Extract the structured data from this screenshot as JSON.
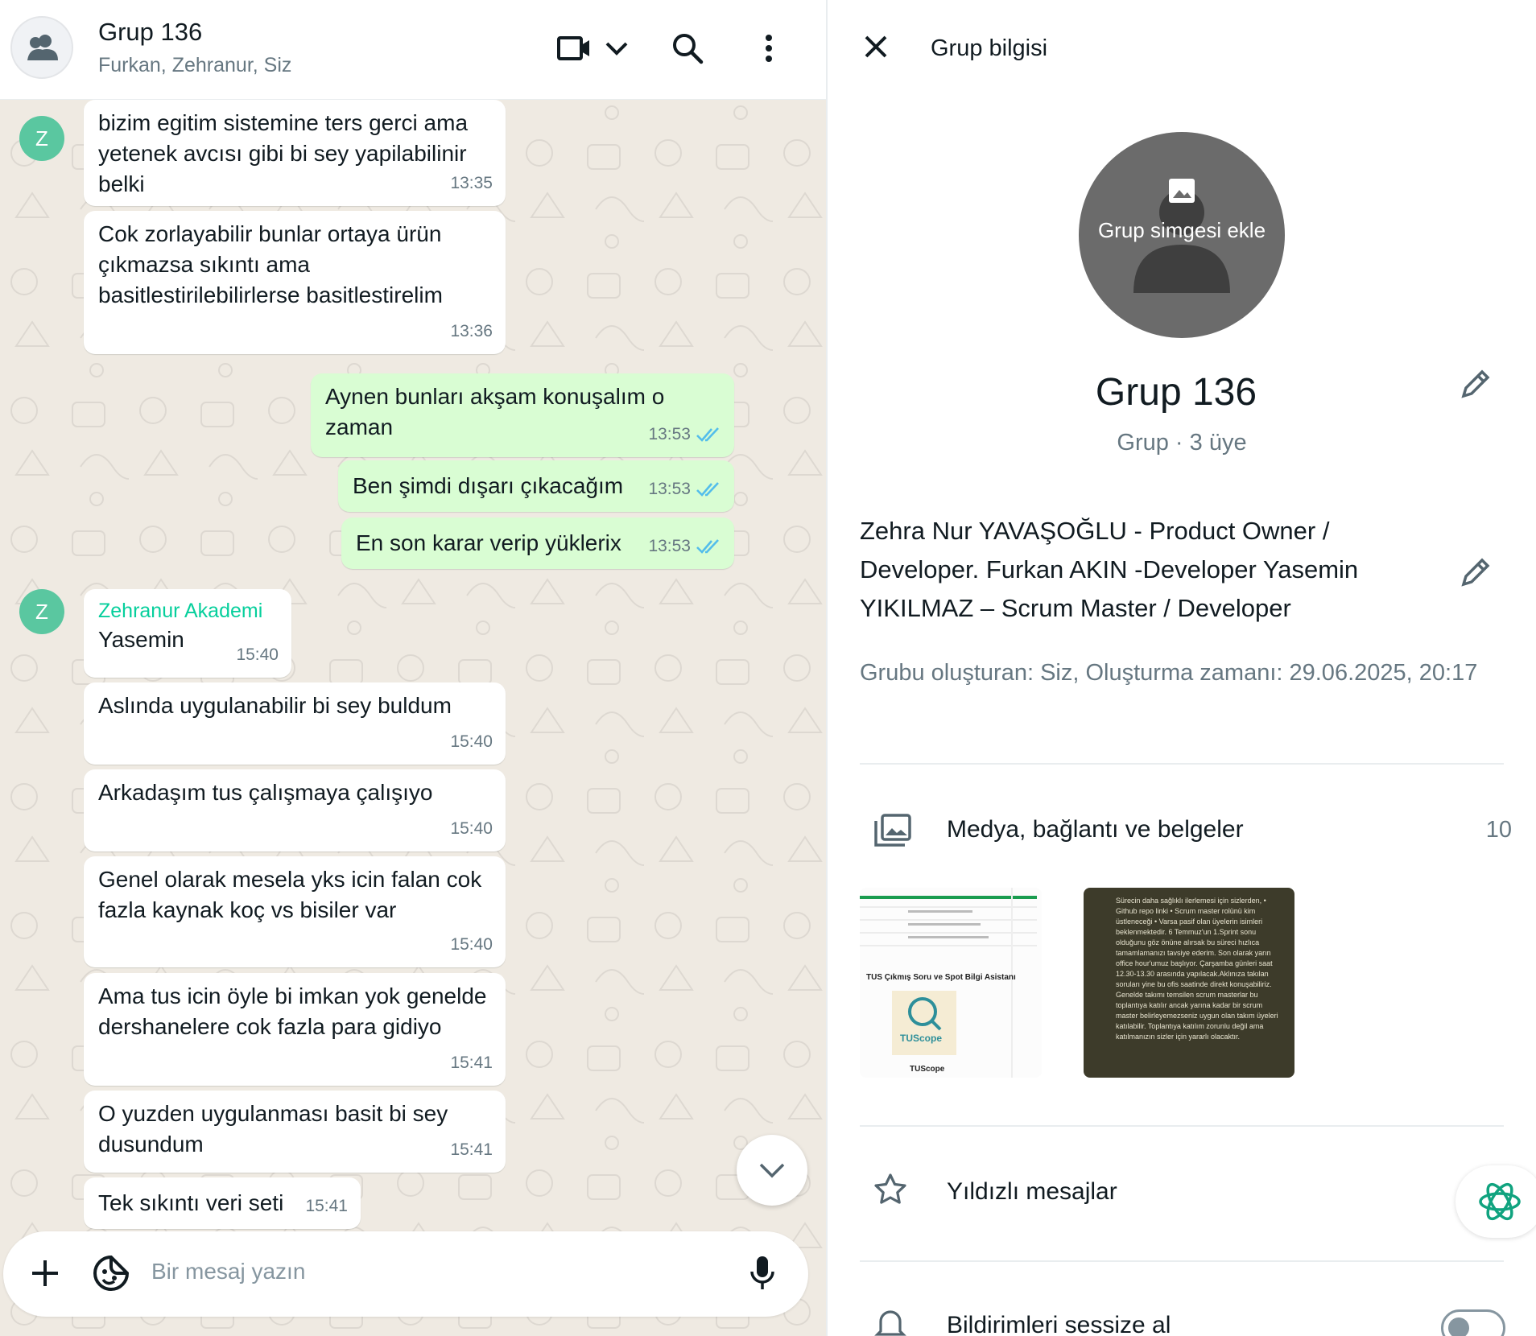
{
  "chat": {
    "title": "Grup 136",
    "members": "Furkan, Zehranur, Siz",
    "avatar_letter": "Z",
    "messages": [
      {
        "dir": "in",
        "text": "bizim egitim sistemine ters gerci ama yetenek avcısı gibi bi sey yapilabilinir belki",
        "time": "13:35"
      },
      {
        "dir": "in",
        "text": "Cok zorlayabilir bunlar ortaya ürün çıkmazsa sıkıntı ama basitlestirilebilirlerse basitlestirelim",
        "time": "13:36"
      },
      {
        "dir": "out",
        "text": "Aynen bunları akşam konuşalım o zaman",
        "time": "13:53"
      },
      {
        "dir": "out",
        "text": "Ben şimdi dışarı çıkacağım",
        "time": "13:53"
      },
      {
        "dir": "out",
        "text": "En son karar verip yüklerix",
        "time": "13:53"
      },
      {
        "dir": "in",
        "sender": "Zehranur Akademi",
        "text": "Yasemin",
        "time": "15:40"
      },
      {
        "dir": "in",
        "text": "Aslında uygulanabilir bi sey buldum",
        "time": "15:40"
      },
      {
        "dir": "in",
        "text": "Arkadaşım tus çalışmaya çalışıyo",
        "time": "15:40"
      },
      {
        "dir": "in",
        "text": "Genel olarak mesela yks icin falan cok fazla kaynak koç vs bisiler var",
        "time": "15:40"
      },
      {
        "dir": "in",
        "text": "Ama tus icin öyle bi imkan yok genelde dershanelere cok fazla para gidiyo",
        "time": "15:41"
      },
      {
        "dir": "in",
        "text": "O yuzden uygulanması basit bi sey dusundum",
        "time": "15:41"
      },
      {
        "dir": "in",
        "text": "Tek sıkıntı veri seti",
        "time": "15:41"
      }
    ],
    "composer_placeholder": "Bir mesaj yazın"
  },
  "info": {
    "title": "Grup bilgisi",
    "avatar_add_text": "Grup simgesi ekle",
    "group_name": "Grup 136",
    "group_meta": "Grup · 3 üye",
    "description": "Zehra Nur YAVAŞOĞLU - Product Owner / Developer. Furkan AKIN -Developer Yasemin YIKILMAZ – Scrum Master / Developer",
    "created": "Grubu oluşturan: Siz, Oluşturma zamanı: 29.06.2025, 20:17",
    "media_label": "Medya, bağlantı ve belgeler",
    "media_count": "10",
    "starred_label": "Yıldızlı mesajlar",
    "mute_label": "Bildirimleri sessize al",
    "mute_enabled": false,
    "thumb1": {
      "caption": "TUS Çıkmış Soru ve Spot Bilgi Asistanı",
      "logo_text": "TUScope",
      "footer": "TUScope"
    },
    "thumb2": {
      "text": "Sürecin daha sağlıklı ilerlemesi için sizlerden, • Github repo linki • Scrum master rolünü kim üstleneceği • Varsa pasif olan üyelerin isimleri beklenmektedir. 6 Temmuz'un 1.Sprint sonu olduğunu göz önüne alırsak bu süreci hızlıca tamamlamanızı tavsiye ederim. Son olarak yarın office hour'umuz başlıyor. Çarşamba günleri saat 12.30-13.30 arasında yapılacak.Aklınıza takılan soruları yine bu ofis saatinde direkt konuşabiliriz. Genelde takımı temsilen scrum masterlar bu toplantıya katılır ancak yarına kadar bir scrum master belirleyemezseniz uygun olan takım üyeleri katılabilir. Toplantıya katılım zorunlu değil ama katılmanızın sizler için yararlı olacaktır."
    }
  }
}
